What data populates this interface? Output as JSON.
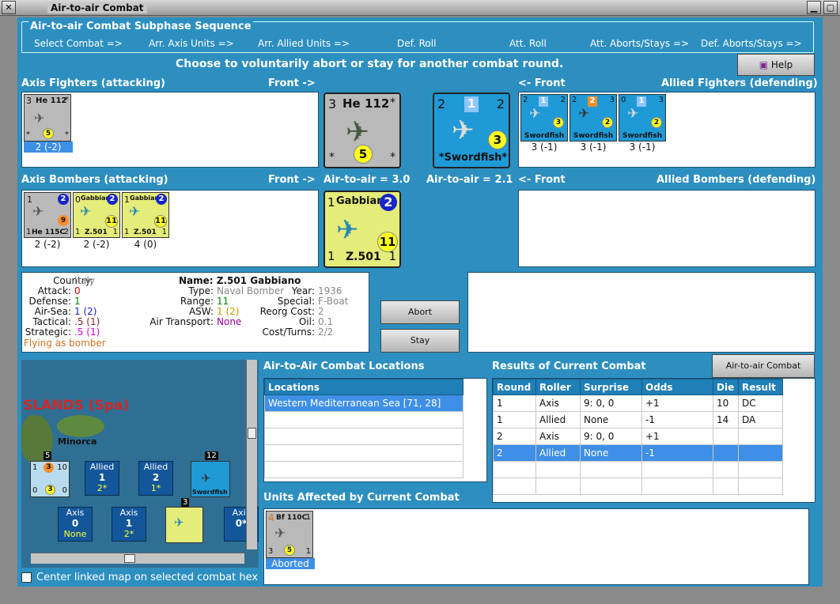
{
  "window": {
    "title": "Air-to-air Combat"
  },
  "sequence": {
    "title": "Air-to-air Combat Subphase Sequence",
    "steps": [
      "Select Combat =>",
      "Arr. Axis Units =>",
      "Arr. Allied Units =>",
      "Def. Roll",
      "Att. Roll",
      "Att. Aborts/Stays =>",
      "Def. Aborts/Stays =>"
    ]
  },
  "instruction": "Choose to voluntarily abort or stay for another combat round.",
  "help_label": "Help",
  "axis_fighters": {
    "header": "Axis Fighters (attacking)",
    "front": "Front ->",
    "units": [
      {
        "name": "He 112",
        "caption": "2 (-2)",
        "top": "3",
        "value": "5",
        "corner1": "*",
        "corner2": "*",
        "corner3": "*"
      }
    ]
  },
  "allied_fighters": {
    "header": "Allied Fighters (defending)",
    "front": "<- Front",
    "units": [
      {
        "name": "Swordfish",
        "caption": "3 (-1)",
        "a": "2",
        "b": "1",
        "c": "2",
        "val": "3"
      },
      {
        "name": "Swordfish",
        "caption": "3 (-1)",
        "a": "2",
        "b": "2",
        "c": "3",
        "val": "2"
      },
      {
        "name": "Swordfish",
        "caption": "3 (-1)",
        "a": "0",
        "b": "1",
        "c": "3",
        "val": "2"
      }
    ]
  },
  "front_axis_fighter": {
    "name": "He 112",
    "top": "3",
    "value": "5",
    "star1": "*",
    "star2": "*",
    "star3": "*",
    "rating": "Air-to-air = 3.0"
  },
  "front_allied_fighter": {
    "name": "*Swordfish*",
    "a": "2",
    "b": "1",
    "c": "2",
    "val": "3",
    "rating": "Air-to-air = 2.1"
  },
  "axis_bombers": {
    "header": "Axis Bombers (attacking)",
    "front": "Front ->",
    "units": [
      {
        "name": "He 115C",
        "caption": "2 (-2)",
        "top": "1",
        "badge": "2",
        "val": "9",
        "bl": "1",
        "br": "2"
      },
      {
        "name": "Gabbiano",
        "sub": "Z.501",
        "caption": "2 (-2)",
        "top": "0",
        "badge": "2",
        "val": "11",
        "bl": "1",
        "br": "1"
      },
      {
        "name": "Gabbiano",
        "sub": "Z.501",
        "caption": "4 (0)",
        "top": "1",
        "badge": "2",
        "val": "11",
        "bl": "1",
        "br": "1"
      }
    ]
  },
  "front_axis_bomber": {
    "name": "Gabbiano",
    "sub": "Z.501",
    "top": "1",
    "badge": "2",
    "val": "11",
    "bl": "1",
    "br": "1"
  },
  "allied_bombers": {
    "header": "Allied Bombers (defending)",
    "front": "<- Front"
  },
  "unit_info": {
    "country_k": "Country:",
    "country_v": "Italy",
    "attack_k": "Attack:",
    "attack_v": "0",
    "defense_k": "Defense:",
    "defense_v": "1",
    "airsea_k": "Air-Sea:",
    "airsea_v": "1 (2)",
    "tactical_k": "Tactical:",
    "tactical_v": ".5 (1)",
    "strategic_k": "Strategic:",
    "strategic_v": ".5 (1)",
    "flying": "Flying as bomber",
    "name": "Name: Z.501 Gabbiano",
    "type_k": "Type:",
    "type_v": "Naval Bomber",
    "year_k": "Year:",
    "year_v": "1936",
    "range_k": "Range:",
    "range_v": "11",
    "special_k": "Special:",
    "special_v": "F-Boat",
    "asw_k": "ASW:",
    "asw_v": "1 (2)",
    "reorg_k": "Reorg Cost:",
    "reorg_v": "2",
    "transport_k": "Air Transport:",
    "transport_v": "None",
    "oil_k": "Oil:",
    "oil_v": "0.1",
    "cost_k": "Cost/Turns:",
    "cost_v": "2/2"
  },
  "buttons": {
    "abort": "Abort",
    "stay": "Stay",
    "chart": "Air-to-air Combat Chart"
  },
  "locations": {
    "header": "Air-to-Air Combat Locations",
    "col": "Locations",
    "rows": [
      "Western Mediterranean Sea [71, 28]"
    ]
  },
  "results": {
    "header": "Results of Current Combat",
    "columns": [
      "Round",
      "Roller",
      "Surprise",
      "Odds",
      "Die",
      "Result"
    ],
    "rows": [
      [
        "1",
        "Axis",
        "9: 0, 0",
        "+1",
        "10",
        "DC"
      ],
      [
        "1",
        "Allied",
        "None",
        "-1",
        "14",
        "DA"
      ],
      [
        "2",
        "Axis",
        "9: 0, 0",
        "+1",
        "",
        ""
      ],
      [
        "2",
        "Allied",
        "None",
        "-1",
        "",
        ""
      ]
    ]
  },
  "affected": {
    "header": "Units Affected by Current Combat",
    "unit_name": "Bf 110C",
    "top": "4",
    "badge": "1",
    "val": "5",
    "bl": "3",
    "br": "1",
    "caption": "Aborted"
  },
  "map": {
    "region": "SLANDS (Spa)",
    "island": "Minorca",
    "boxes": [
      {
        "side": "Allied",
        "num": "1",
        "sub": "2*"
      },
      {
        "side": "Allied",
        "num": "2",
        "sub": "1*"
      },
      {
        "side": "Axis",
        "num": "0",
        "sub": "None"
      },
      {
        "side": "Axis",
        "num": "1",
        "sub": "2*"
      },
      {
        "side": "Axis",
        "num": "0*",
        "sub": ""
      }
    ],
    "stack1": "5",
    "stack2": "12",
    "stack3": "3",
    "s1a": "1",
    "s1b": "3",
    "s1c": "10",
    "s1d": "0",
    "s1e": "3",
    "s1f": "0",
    "sw": "Swordfish"
  },
  "center_map_label": "Center linked map on selected combat hex",
  "colors": {
    "panel": "#2d8fc0",
    "selection": "#3e8fe6",
    "gray": "#b9b9b9"
  }
}
